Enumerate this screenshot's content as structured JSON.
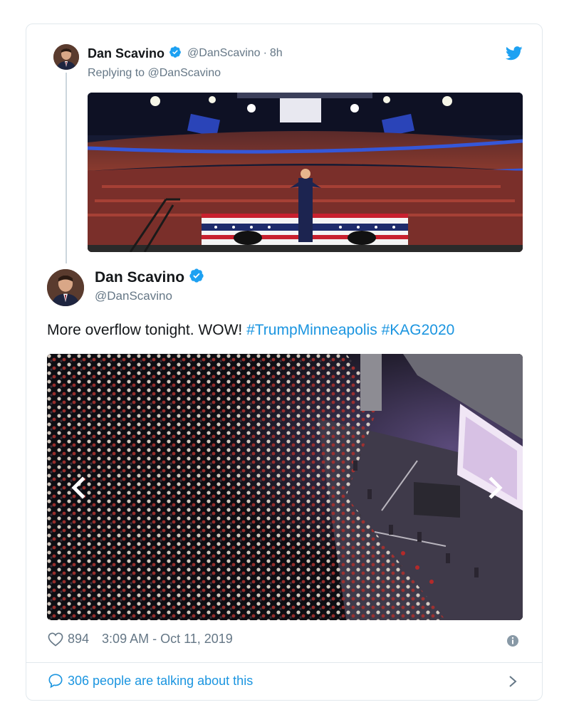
{
  "parent_tweet": {
    "author_name": "Dan Scavino",
    "author_handle": "@DanScavino",
    "separator": "·",
    "time": "8h",
    "replying_prefix": "Replying to",
    "replying_to": "@DanScavino",
    "media_icon": "rally-arena-photo"
  },
  "main_tweet": {
    "author_name": "Dan Scavino",
    "author_handle": "@DanScavino",
    "text_plain": "More overflow tonight. WOW! ",
    "hashtag_1": "#TrumpMinneapolis",
    "hashtag_2": "#KAG2020",
    "media_icon": "crowd-overflow-photo"
  },
  "footer": {
    "like_count": "894",
    "timestamp": "3:09 AM - Oct 11, 2019",
    "talking_text": "306 people are talking about this"
  },
  "colors": {
    "accent": "#1b95e0",
    "text": "#14171a",
    "muted": "#657786",
    "border": "#e1e8ed",
    "verified": "#1da1f2"
  }
}
